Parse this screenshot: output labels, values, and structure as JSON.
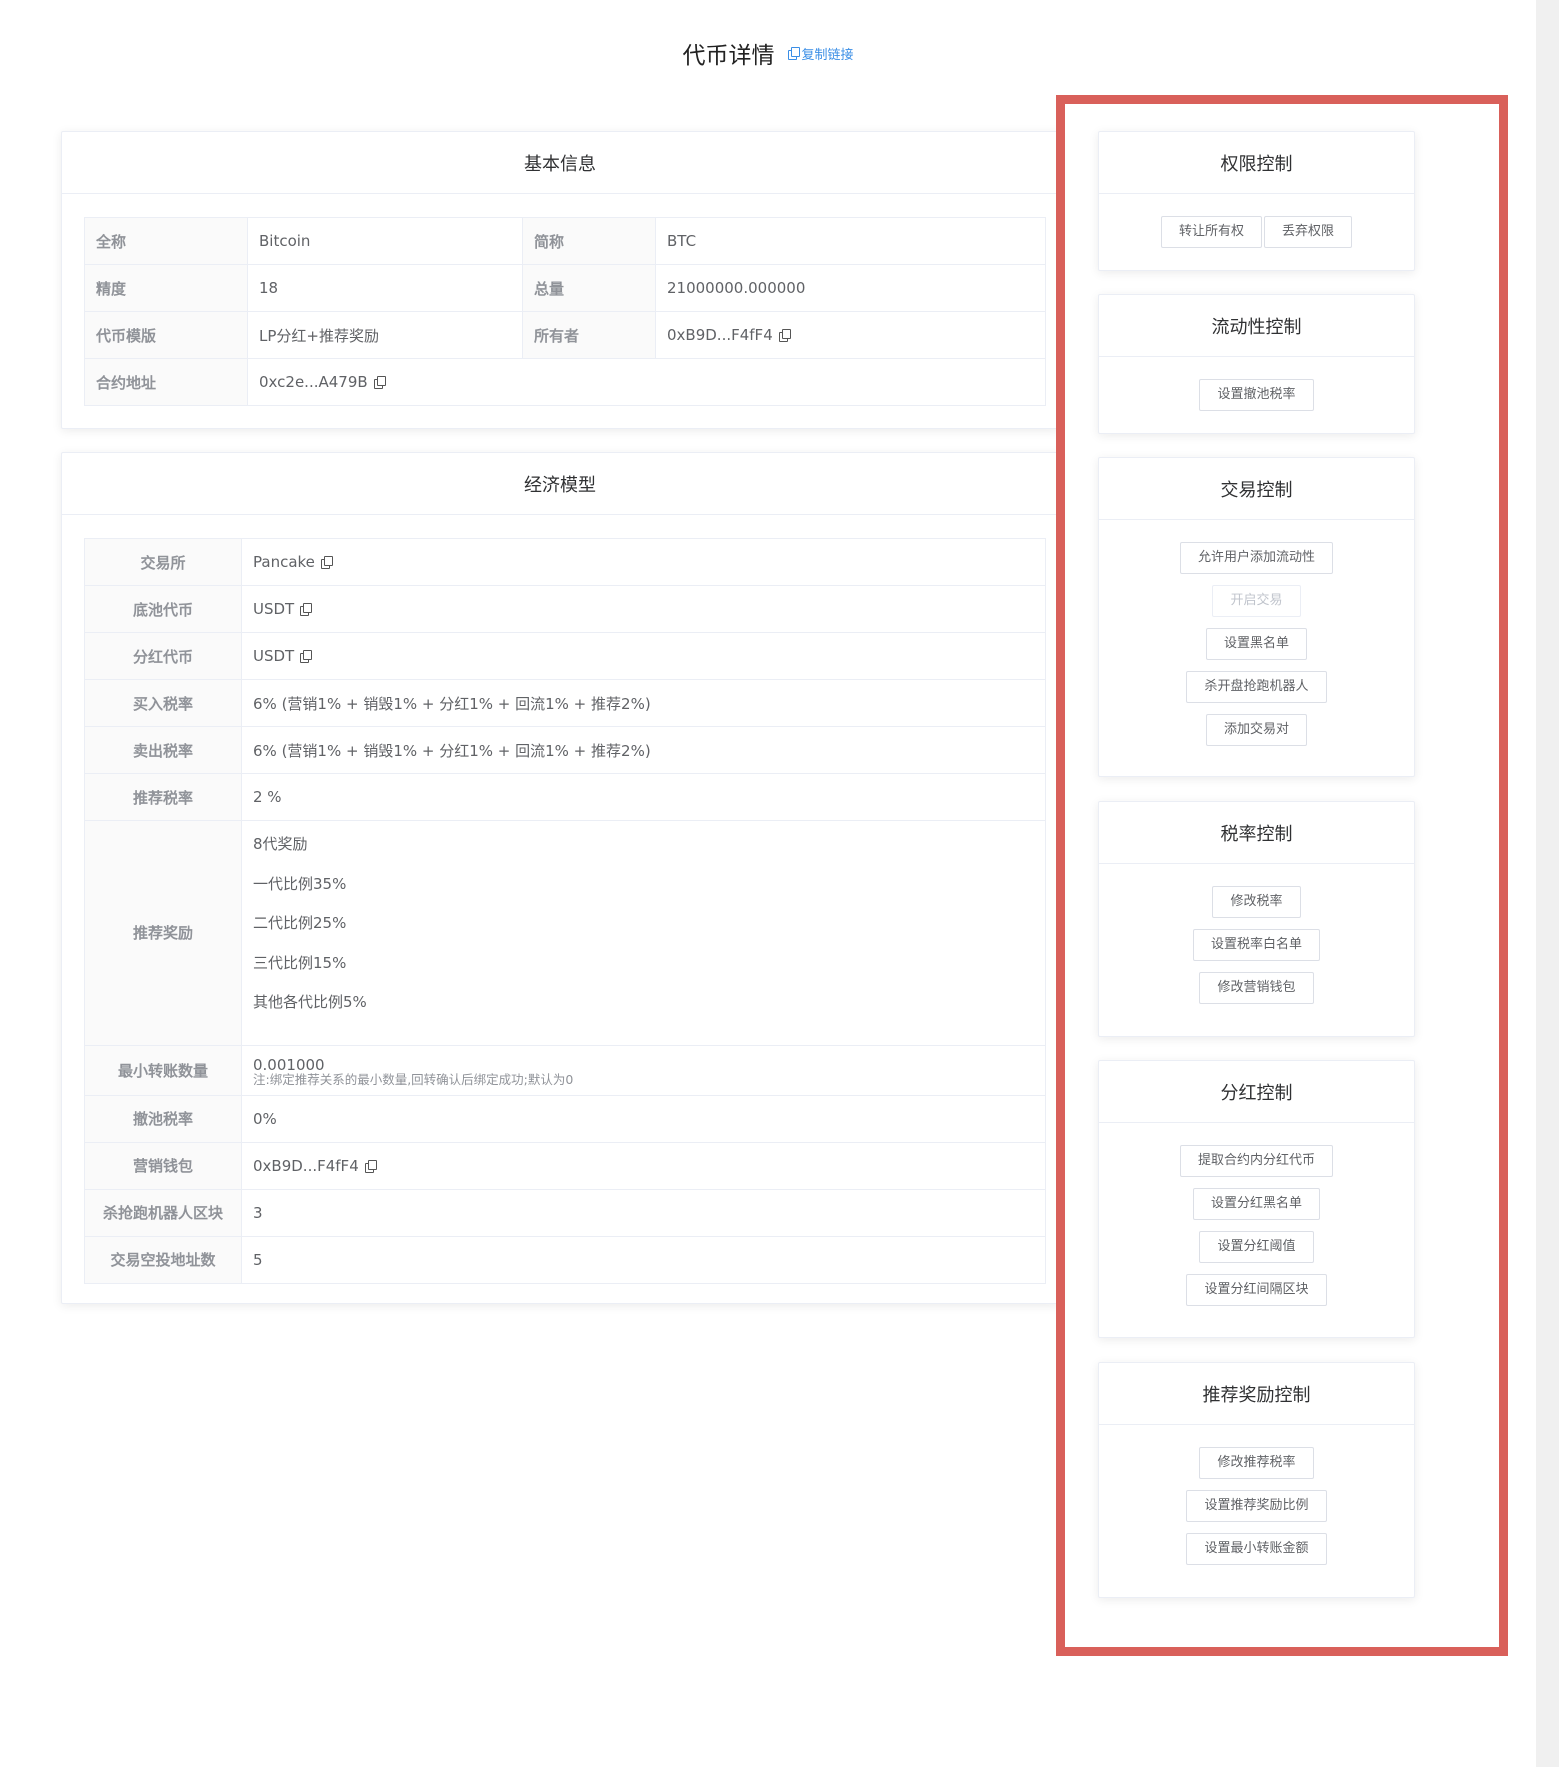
{
  "header": {
    "title": "代币详情",
    "copy_link": "复制链接"
  },
  "basic": {
    "title": "基本信息",
    "rows": [
      {
        "l1": "全称",
        "v1": "Bitcoin",
        "l2": "简称",
        "v2": "BTC"
      },
      {
        "l1": "精度",
        "v1": "18",
        "l2": "总量",
        "v2": "21000000.000000"
      },
      {
        "l1": "代币模版",
        "v1": "LP分红+推荐奖励",
        "l2": "所有者",
        "v2": "0xB9D...F4fF4"
      },
      {
        "l1": "合约地址",
        "v1": "0xc2e...A479B"
      }
    ]
  },
  "econ": {
    "title": "经济模型",
    "exchange": {
      "label": "交易所",
      "value": "Pancake"
    },
    "base_token": {
      "label": "底池代币",
      "value": "USDT"
    },
    "dividend_token": {
      "label": "分红代币",
      "value": "USDT"
    },
    "buy_tax": {
      "label": "买入税率",
      "value": "6% (营销1% + 销毁1% + 分红1% + 回流1% + 推荐2%)"
    },
    "sell_tax": {
      "label": "卖出税率",
      "value": "6% (营销1% + 销毁1% + 分红1% + 回流1% + 推荐2%)"
    },
    "referral_tax": {
      "label": "推荐税率",
      "value": "2 %"
    },
    "referral_reward": {
      "label": "推荐奖励",
      "lines": [
        "8代奖励",
        "一代比例35%",
        "二代比例25%",
        "三代比例15%",
        "其他各代比例5%"
      ]
    },
    "min_transfer": {
      "label": "最小转账数量",
      "value": "0.001000",
      "note": "注:绑定推荐关系的最小数量,回转确认后绑定成功;默认为0"
    },
    "remove_lp_tax": {
      "label": "撤池税率",
      "value": "0%"
    },
    "marketing_wallet": {
      "label": "营销钱包",
      "value": "0xB9D...F4fF4"
    },
    "anti_bot_blocks": {
      "label": "杀抢跑机器人区块",
      "value": "3"
    },
    "airdrop_count": {
      "label": "交易空投地址数",
      "value": "5"
    }
  },
  "controls": {
    "permission": {
      "title": "权限控制",
      "buttons": [
        "转让所有权",
        "丢弃权限"
      ]
    },
    "liquidity": {
      "title": "流动性控制",
      "buttons": [
        "设置撤池税率"
      ]
    },
    "trade": {
      "title": "交易控制",
      "buttons": [
        "允许用户添加流动性",
        "开启交易",
        "设置黑名单",
        "杀开盘抢跑机器人",
        "添加交易对"
      ]
    },
    "tax": {
      "title": "税率控制",
      "buttons": [
        "修改税率",
        "设置税率白名单",
        "修改营销钱包"
      ]
    },
    "dividend": {
      "title": "分红控制",
      "buttons": [
        "提取合约内分红代币",
        "设置分红黑名单",
        "设置分红阈值",
        "设置分红间隔区块"
      ]
    },
    "referral": {
      "title": "推荐奖励控制",
      "buttons": [
        "修改推荐税率",
        "设置推荐奖励比例",
        "设置最小转账金额"
      ]
    }
  },
  "colors": {
    "highlight_frame": "#d9605a",
    "link": "#3a8ee6"
  }
}
